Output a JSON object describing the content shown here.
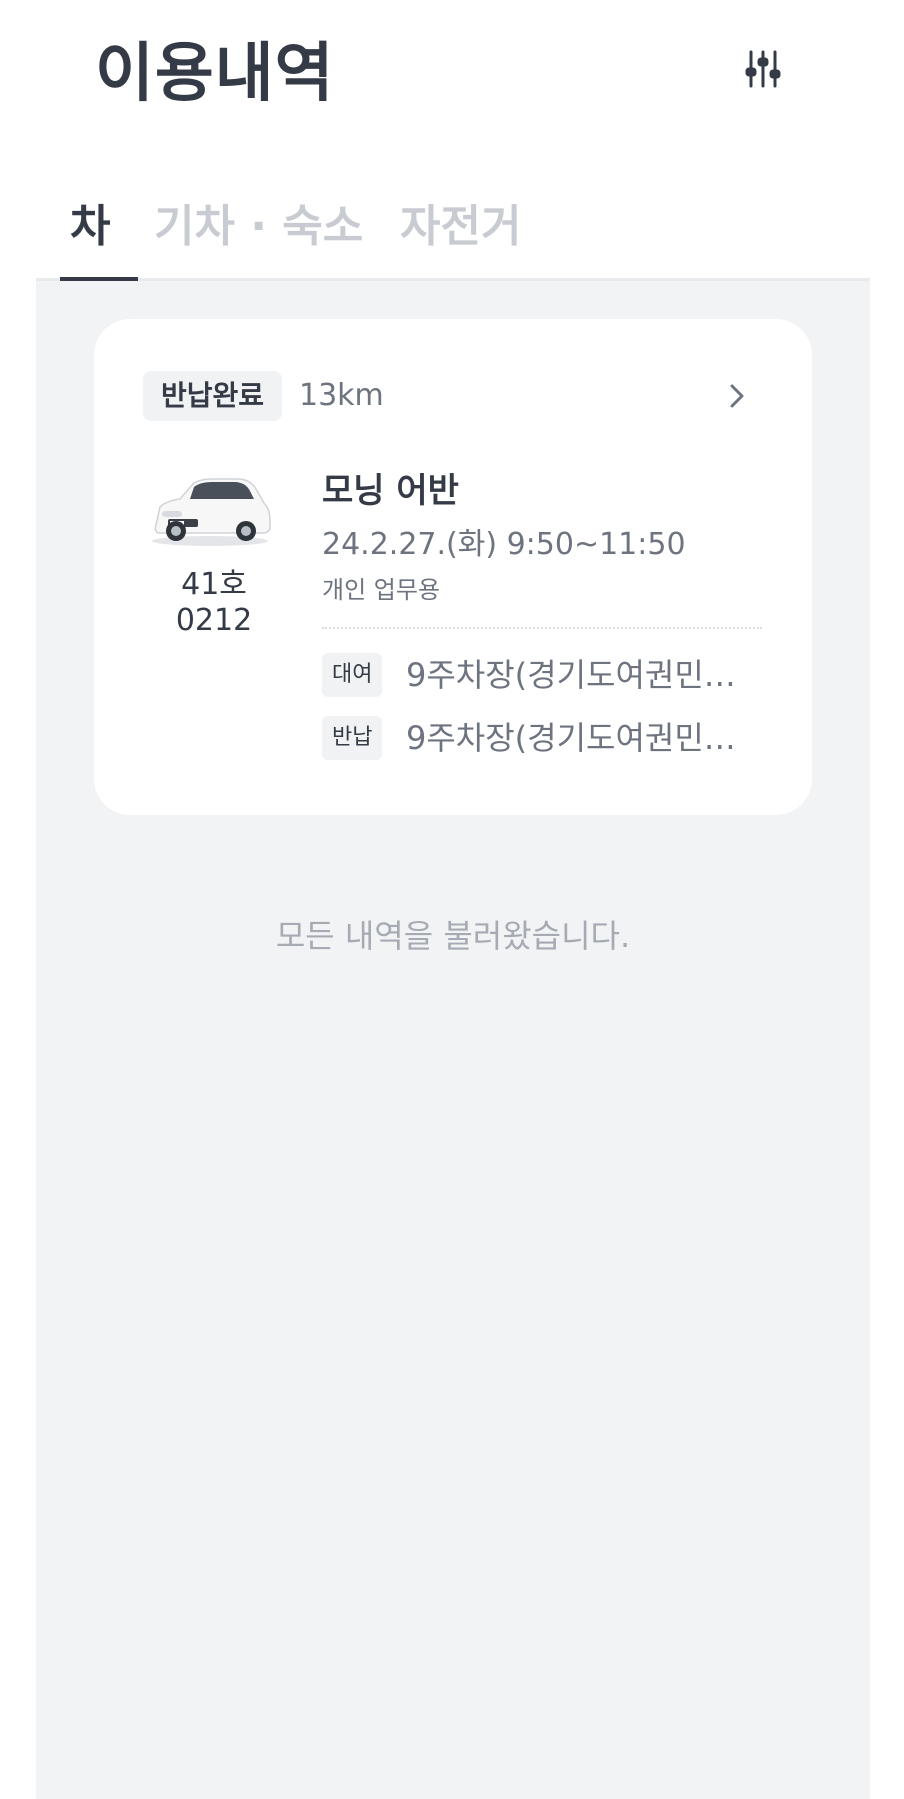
{
  "header": {
    "title": "이용내역",
    "filter_icon": "sliders-icon"
  },
  "tabs": [
    {
      "label": "차",
      "active": true
    },
    {
      "label": "기차 · 숙소",
      "active": false
    },
    {
      "label": "자전거",
      "active": false
    }
  ],
  "history": [
    {
      "status": "반납완료",
      "distance": "13km",
      "car_image": "car-image",
      "plate": "41호0212",
      "model": "모닝 어반",
      "datetime": "24.2.27.(화) 9:50~11:50",
      "purpose": "개인 업무용",
      "rental": {
        "label": "대여",
        "location": "9주차장(경기도여권민…"
      },
      "return": {
        "label": "반납",
        "location": "9주차장(경기도여권민…"
      }
    }
  ],
  "list_end_message": "모든 내역을 불러왔습니다.",
  "colors": {
    "text_primary": "#343b46",
    "text_secondary": "#6d7480",
    "tab_inactive": "#c8ccd2",
    "list_background": "#f2f3f5",
    "card_background": "#ffffff"
  }
}
